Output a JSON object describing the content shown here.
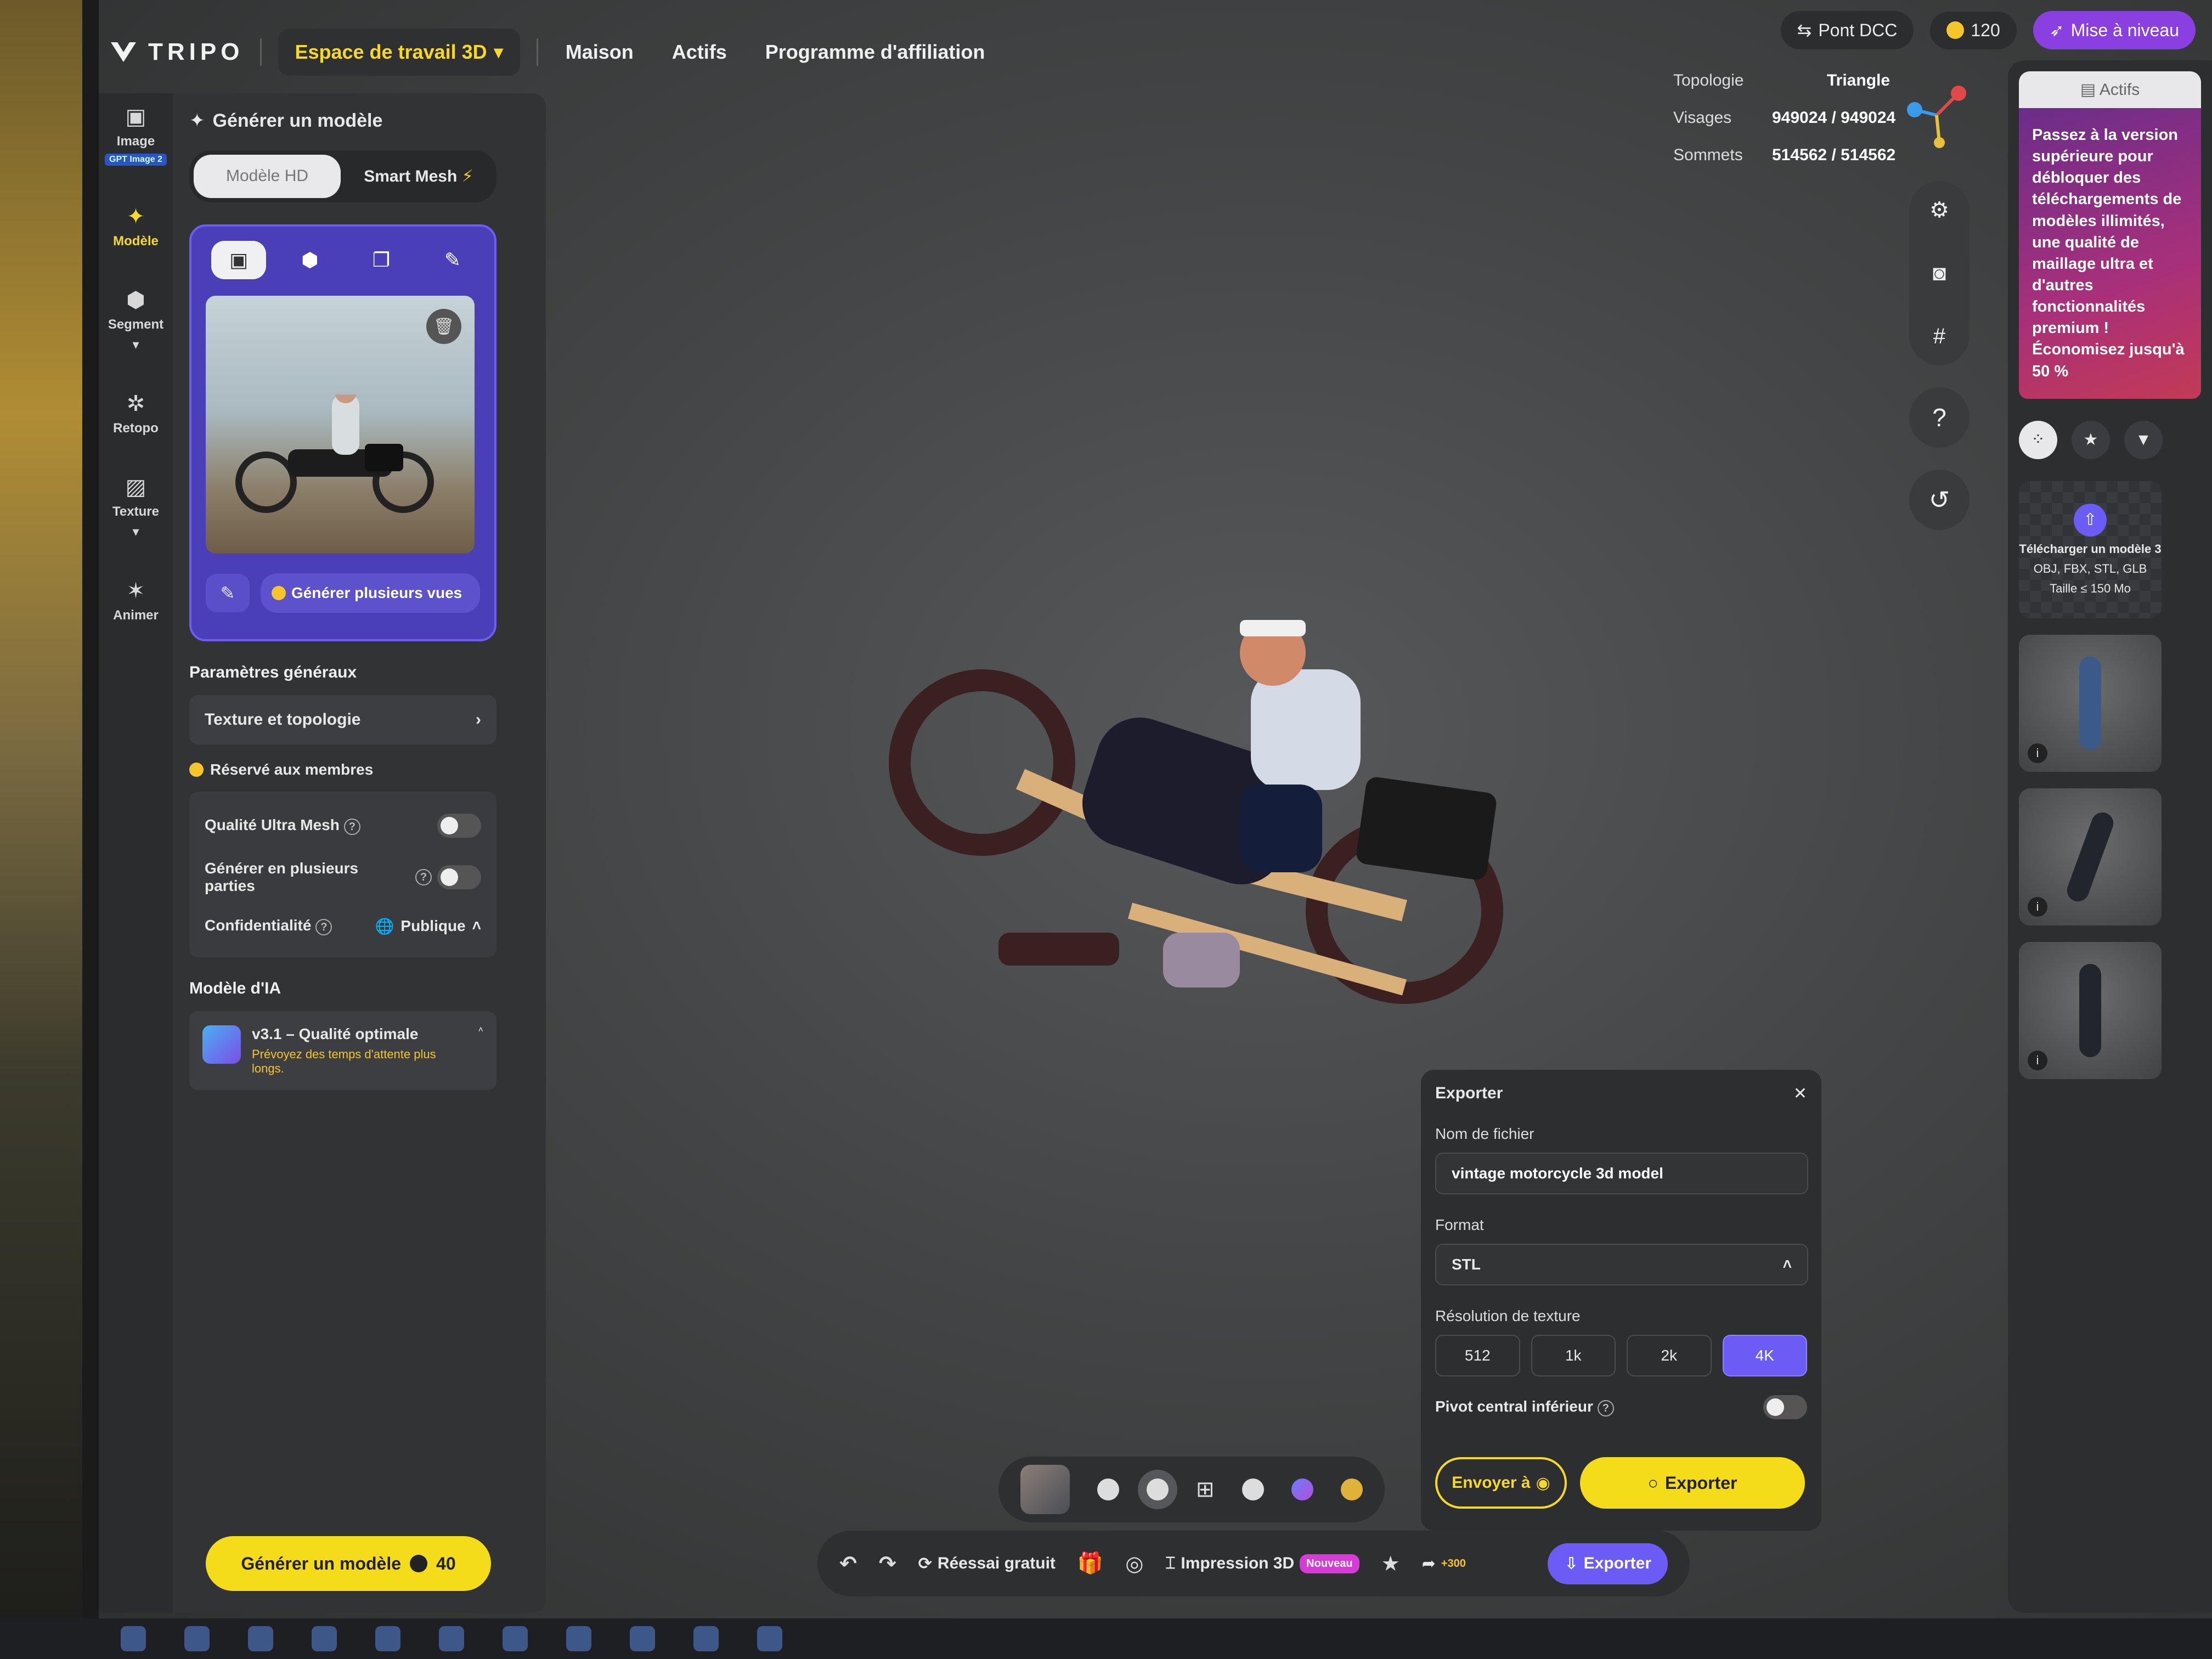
{
  "app": {
    "logo_text": "TRIPO",
    "workspace_label": "Espace de travail 3D",
    "nav": [
      "Maison",
      "Actifs",
      "Programme d'affiliation"
    ],
    "dcc_label": "Pont DCC",
    "credits": "120",
    "upgrade_label": "Mise à niveau",
    "accent_color": "#f5dc1a",
    "brand_purple": "#6b5cf5"
  },
  "rail": {
    "items": [
      {
        "label": "Image",
        "icon": "image-icon",
        "badge": "GPT Image 2"
      },
      {
        "label": "Modèle",
        "icon": "sparkle-icon"
      },
      {
        "label": "Segment",
        "icon": "cube-icon"
      },
      {
        "label": "Retopo",
        "icon": "mesh-icon"
      },
      {
        "label": "Texture",
        "icon": "texture-icon"
      },
      {
        "label": "Animer",
        "icon": "figure-icon"
      }
    ]
  },
  "panel": {
    "title": "Générer un modèle",
    "mode_hd": "Modèle HD",
    "mode_smart": "Smart Mesh",
    "multi_view_label": "Générer plusieurs vues",
    "general_params": "Paramètres généraux",
    "texture_topology": "Texture et topologie",
    "members_only": "Réservé aux membres",
    "ultra_mesh": "Qualité Ultra Mesh",
    "multi_parts": "Générer en plusieurs parties",
    "privacy": "Confidentialité",
    "privacy_value": "Publique",
    "ai_model_label": "Modèle d'IA",
    "ai_model_name": "v3.1 – Qualité optimale",
    "ai_model_note": "Prévoyez des temps d'attente plus longs.",
    "generate_label": "Générer un modèle",
    "generate_cost": "40"
  },
  "stats": {
    "topology_key": "Topologie",
    "topology_val": "Triangle",
    "faces_key": "Visages",
    "faces_val": "949024 / 949024",
    "vertices_key": "Sommets",
    "vertices_val": "514562 / 514562"
  },
  "assets": {
    "tab_label": "Actifs",
    "promo": "Passez à la version supérieure pour débloquer des téléchargements de modèles illimités, une qualité de maillage ultra et d'autres fonctionnalités premium ! Économisez jusqu'à 50 %",
    "upload_title": "Télécharger un modèle 3",
    "upload_formats": "OBJ, FBX, STL, GLB",
    "upload_size": "Taille ≤ 150 Mo"
  },
  "actionbar": {
    "free_retry": "Réessai gratuit",
    "print3d": "Impression 3D",
    "new_badge": "Nouveau",
    "share_bonus": "+300",
    "export": "Exporter"
  },
  "dialog": {
    "title": "Exporter",
    "filename_label": "Nom de fichier",
    "filename_value": "vintage motorcycle 3d model",
    "format_label": "Format",
    "format_value": "STL",
    "texture_res_label": "Résolution de texture",
    "resolutions": [
      "512",
      "1k",
      "2k",
      "4K"
    ],
    "selected_resolution": "4K",
    "pivot_label": "Pivot central inférieur",
    "send_label": "Envoyer à",
    "export_label": "Exporter"
  }
}
